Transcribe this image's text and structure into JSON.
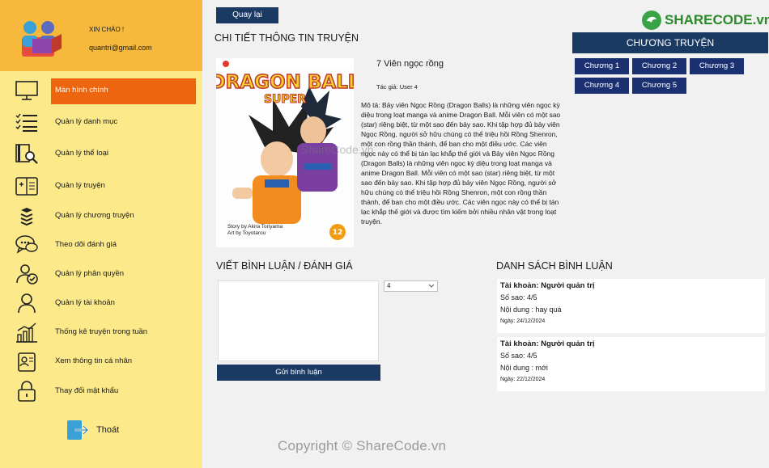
{
  "profile": {
    "greeting": "XIN CHÀO !",
    "email": "quantri@gmail.com"
  },
  "nav": [
    {
      "label": "Màn hình chính",
      "icon": "monitor-icon",
      "active": true
    },
    {
      "label": "Quản lý danh mục",
      "icon": "list-icon"
    },
    {
      "label": "Quản lý thể loại",
      "icon": "book-search-icon"
    },
    {
      "label": "Quản lý truyện",
      "icon": "open-book-icon"
    },
    {
      "label": "Quản lý chương truyện",
      "icon": "stack-icon"
    },
    {
      "label": "Theo dõi đánh giá",
      "icon": "chat-icon"
    },
    {
      "label": "Quản lý phân quyền",
      "icon": "user-check-icon"
    },
    {
      "label": "Quản lý tài khoản",
      "icon": "user-icon"
    },
    {
      "label": "Thống kê truyện trong tuần",
      "icon": "bar-chart-icon"
    },
    {
      "label": "Xem thông tin cá nhân",
      "icon": "id-card-icon"
    },
    {
      "label": "Thay đổi mật khẩu",
      "icon": "lock-icon"
    }
  ],
  "logout": {
    "label": "Thoát",
    "icon": "logout-icon"
  },
  "main": {
    "back_label": "Quay lại",
    "detail_title": "CHI TIẾT THÔNG TIN TRUYỆN",
    "story": {
      "name": "7 Viên ngọc rồng",
      "author": "Tác giả: User 4",
      "description": "Mô tả: Bảy viên Ngọc Rồng (Dragon Balls) là những viên ngọc kỳ diệu trong loạt manga và anime Dragon Ball. Mỗi viên có một sao (star) riêng biệt, từ một sao đến bảy sao. Khi tập hợp đủ bảy viên Ngọc Rồng, người sở hữu chúng có thể triệu hồi Rồng Shenron, một con rồng thần thánh, để ban cho một điều ước. Các viên ngọc này có thể bị tán lạc khắp thế giới và Bảy viên Ngọc Rồng (Dragon Balls) là những viên ngọc kỳ diệu trong loạt manga và anime Dragon Ball. Mỗi viên có một sao (star) riêng biệt, từ một sao đến bảy sao. Khi tập hợp đủ bảy viên Ngọc Rồng, người sở hữu chúng có thể triệu hồi Rồng Shenron, một con rồng thần thánh, để ban cho một điều ước. Các viên ngọc này có thể bị tán lạc khắp thế giới và được tìm kiếm bởi nhiều nhân vật trong loạt truyện.",
      "cover": {
        "title_line1": "DRAGON BALL",
        "title_line2": "SUPER",
        "credit1": "Story by Akira Toriyama",
        "credit2": "Art by Toyotarou",
        "volume": "12"
      }
    },
    "chapters_title": "CHƯƠNG TRUYỆN",
    "chapters": [
      "Chương 1",
      "Chương 2",
      "Chương 3",
      "Chương 4",
      "Chương 5"
    ],
    "write_title": "VIẾT BÌNH LUẬN / ĐÁNH GIÁ",
    "comment_value": "",
    "rating_value": "4",
    "send_label": "Gửi bình luận",
    "list_title": "DANH SÁCH BÌNH LUẬN",
    "reviews": [
      {
        "account": "Tài khoản: Người quản trị",
        "stars": "Số sao: 4/5",
        "content": "Nội dung : hay quá",
        "date": "Ngày: 24/12/2024"
      },
      {
        "account": "Tài khoản: Người quản trị",
        "stars": "Số sao: 4/5",
        "content": "Nội dung : mới",
        "date": "Ngày: 22/12/2024"
      }
    ]
  },
  "brand": {
    "name": "SHARECODE.vn"
  },
  "watermark": {
    "center": "ShareCode.vn",
    "footer": "Copyright © ShareCode.vn"
  },
  "colors": {
    "accent": "#ee6510",
    "navy": "#1b3a63",
    "sidebar": "#fbe98a",
    "profile": "#f6b93b"
  }
}
